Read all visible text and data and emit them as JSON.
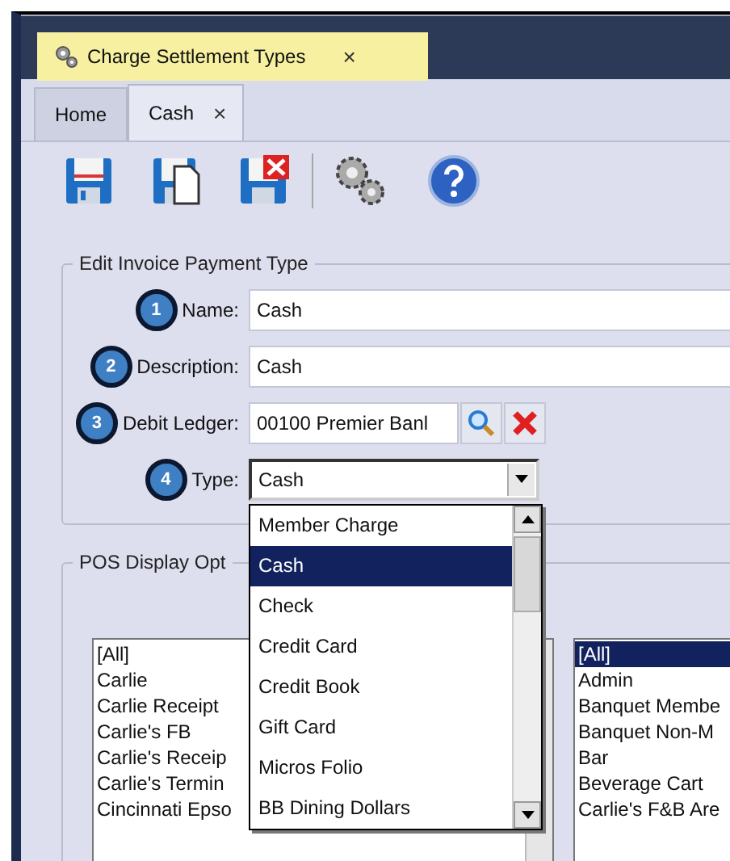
{
  "document_tab": {
    "label": "Charge Settlement Types",
    "close": "×"
  },
  "tabs": [
    {
      "label": "Home",
      "selected": false
    },
    {
      "label": "Cash",
      "selected": true,
      "close": "×"
    }
  ],
  "edit_group": {
    "title": "Edit Invoice Payment Type",
    "fields": [
      {
        "step": "1",
        "label": "Name:",
        "kind": "text",
        "value": "Cash"
      },
      {
        "step": "2",
        "label": "Description:",
        "kind": "text",
        "value": "Cash"
      },
      {
        "step": "3",
        "label": "Debit Ledger:",
        "kind": "lookup",
        "value": "00100 Premier Banl"
      },
      {
        "step": "4",
        "label": "Type:",
        "kind": "dropdown",
        "value": "Cash",
        "expanded": true,
        "options": [
          {
            "label": "Member Charge",
            "selected": false
          },
          {
            "label": "Cash",
            "selected": true
          },
          {
            "label": "Check",
            "selected": false
          },
          {
            "label": "Credit Card",
            "selected": false
          },
          {
            "label": "Credit Book",
            "selected": false
          },
          {
            "label": "Gift Card",
            "selected": false
          },
          {
            "label": "Micros Folio",
            "selected": false
          },
          {
            "label": "BB Dining Dollars",
            "selected": false
          }
        ]
      }
    ]
  },
  "pos_group": {
    "title": "POS Display Opt",
    "list_1": [
      {
        "label": "[All]",
        "selected": false
      },
      {
        "label": "Carlie",
        "selected": false
      },
      {
        "label": "Carlie Receipt",
        "selected": false
      },
      {
        "label": "Carlie's  FB",
        "selected": false
      },
      {
        "label": "Carlie's Receip",
        "selected": false
      },
      {
        "label": "Carlie's Termin",
        "selected": false
      },
      {
        "label": "Cincinnati Epso",
        "selected": false
      }
    ],
    "list_2": [
      {
        "label": "[All]",
        "selected": true
      },
      {
        "label": "Admin",
        "selected": false
      },
      {
        "label": "Banquet Membe",
        "selected": false
      },
      {
        "label": "Banquet Non-M",
        "selected": false
      },
      {
        "label": "Bar",
        "selected": false
      },
      {
        "label": "Beverage Cart",
        "selected": false
      },
      {
        "label": "Carlie's F&B Are",
        "selected": false
      }
    ]
  }
}
